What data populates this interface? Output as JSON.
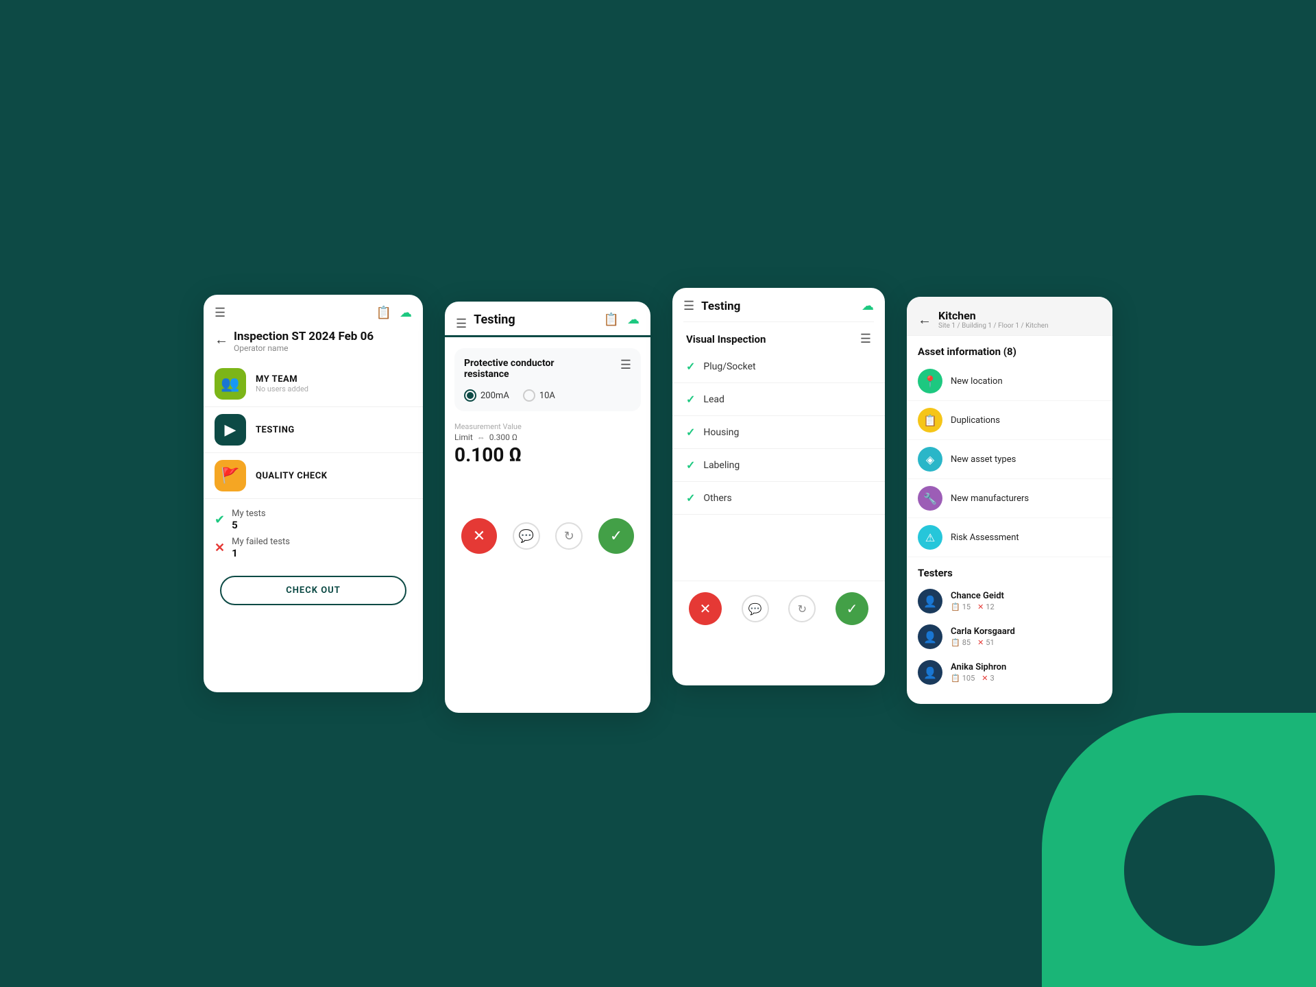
{
  "background": "#0d4a45",
  "panel1": {
    "title": "Inspection ST 2024 Feb 06",
    "subtitle": "Operator name",
    "sections": [
      {
        "id": "team",
        "label": "MY TEAM",
        "sublabel": "No users added",
        "icon": "👥",
        "iconClass": "icon-green"
      },
      {
        "id": "testing",
        "label": "TESTING",
        "sublabel": "",
        "icon": "▶",
        "iconClass": "icon-teal"
      },
      {
        "id": "quality",
        "label": "QUALITY CHECK",
        "sublabel": "",
        "icon": "🚩",
        "iconClass": "icon-orange"
      }
    ],
    "stats": [
      {
        "id": "my-tests",
        "label": "My tests",
        "value": "5",
        "icon": "✅",
        "iconColor": "green"
      },
      {
        "id": "my-failed",
        "label": "My failed tests",
        "value": "1",
        "icon": "✗",
        "iconColor": "red"
      }
    ],
    "checkout_label": "CHECK OUT"
  },
  "panel2": {
    "title": "Testing",
    "test_card": {
      "title": "Protective conductor resistance",
      "options": [
        {
          "id": "200mA",
          "label": "200mA",
          "selected": true
        },
        {
          "id": "10A",
          "label": "10A",
          "selected": false
        }
      ],
      "measurement_label": "Measurement Value",
      "limit_label": "Limit",
      "limit_value": "0.300 Ω",
      "measurement_value": "0.100 Ω"
    },
    "actions": {
      "reject": "✕",
      "comment": "💬",
      "retry": "↻",
      "accept": "✓"
    }
  },
  "panel3": {
    "title": "Testing",
    "section_title": "Visual Inspection",
    "checklist": [
      {
        "id": "plug-socket",
        "label": "Plug/Socket",
        "checked": true
      },
      {
        "id": "lead",
        "label": "Lead",
        "checked": true
      },
      {
        "id": "housing",
        "label": "Housing",
        "checked": true
      },
      {
        "id": "labeling",
        "label": "Labeling",
        "checked": true
      },
      {
        "id": "others",
        "label": "Others",
        "checked": true
      }
    ],
    "actions": {
      "reject": "✕",
      "comment": "💬",
      "retry": "↻",
      "accept": "✓"
    }
  },
  "panel4": {
    "title": "Kitchen",
    "breadcrumb": "Site 1 / Building 1 / Floor 1 / Kitchen",
    "asset_section_title": "Asset information (8)",
    "asset_items": [
      {
        "id": "new-location",
        "label": "New location",
        "icon": "📍",
        "iconClass": "ai-green"
      },
      {
        "id": "duplications",
        "label": "Duplications",
        "icon": "📋",
        "iconClass": "ai-yellow"
      },
      {
        "id": "new-asset-types",
        "label": "New asset types",
        "icon": "◈",
        "iconClass": "ai-teal"
      },
      {
        "id": "new-manufacturers",
        "label": "New manufacturers",
        "icon": "🔧",
        "iconClass": "ai-purple"
      },
      {
        "id": "risk-assessment",
        "label": "Risk Assessment",
        "icon": "⚠",
        "iconClass": "ai-cyan"
      }
    ],
    "testers_title": "Testers",
    "testers": [
      {
        "id": "chance-geidt",
        "name": "Chance Geidt",
        "tests": 15,
        "failed": 12
      },
      {
        "id": "carla-korsgaard",
        "name": "Carla Korsgaard",
        "tests": 85,
        "failed": 51
      },
      {
        "id": "anika-siphron",
        "name": "Anika Siphron",
        "tests": 105,
        "failed": 3
      }
    ]
  }
}
